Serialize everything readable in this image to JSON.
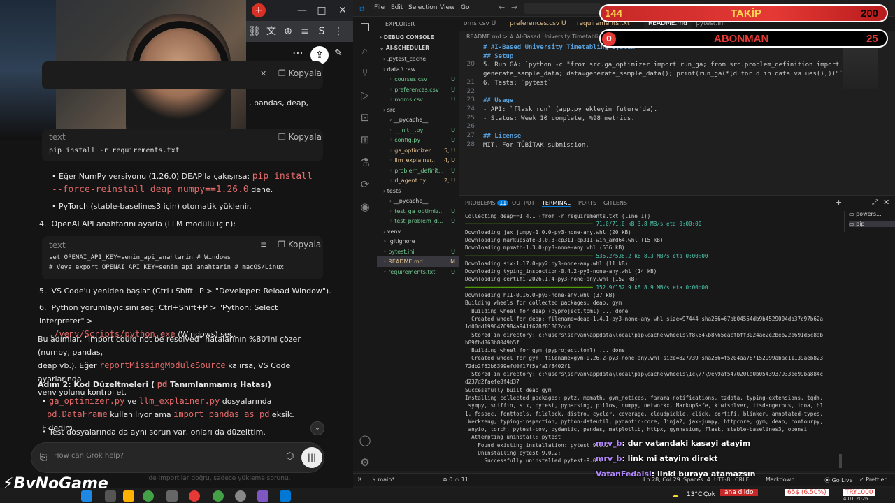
{
  "browser": {
    "kopyala": "Kopyala"
  },
  "chat": {
    "partial_top": ", pandas, deap,",
    "code1": {
      "lang": "text",
      "copy": "Kopyala",
      "line": "pip install -r requirements.txt"
    },
    "bullet1_pre": "Eğer NumPy versiyonu (1.26.0) DEAP'la çakışırsa: ",
    "bullet1_code": "pip install --force-reinstall deap numpy==1.26.0",
    "bullet1_post": " dene.",
    "bullet2": "PyTorch (stable-baselines3 için) otomatik yüklenir.",
    "step4": "OpenAI API anahtarını ayarla (LLM modülü için):",
    "code2": {
      "lang": "text",
      "copy": "Kopyala",
      "line1": "set OPENAI_API_KEY=senin_api_anahtarin  # Windows",
      "line2": "# Veya export OPENAI_API_KEY=senin_api_anahtarin  # macOS/Linux"
    },
    "step5": "VS Code'u yeniden başlat (Ctrl+Shift+P > \"Developer: Reload Window\").",
    "step6_pre": "Python yorumlayıcısını seç: Ctrl+Shift+P > \"Python: Select Interpreter\" >",
    "step6_code": "./venv/Scripts/python.exe",
    "step6_post": " (Windows) seç.",
    "para1": "Bu adımlar, \"Import could not be resolved\" hatalarının %80'ini çözer (numpy, pandas,",
    "para2_pre": "deap vb.). Eğer ",
    "para2_code": "reportMissingModuleSource",
    "para2_post": " kalırsa, VS Code ayarlarında",
    "para3": "venv yolunu kontrol et.",
    "heading_pre": "Adım 2: Kod Düzeltmeleri ( ",
    "heading_code": "pd",
    "heading_post": " Tanımlanmamış Hatası)",
    "b3_code1": "ga_optimizer.py",
    "b3_mid": " ve ",
    "b3_code2": "llm_explainer.py",
    "b3_post": " dosyalarında",
    "b4_code1": "pd.DataFrame",
    "b4_mid": " kullanılıyor ama ",
    "b4_code2": "import pandas as pd",
    "b4_post": " eksik. Ekledim.",
    "b5": "Test dosyalarında da aynı sorun var, onları da düzelttim.",
    "input_placeholder": "How can Grok help?",
    "behind_text": "'de import'lar doğru, sadece yükleme sorunu."
  },
  "brand": "ByNoGame",
  "vscode": {
    "menu": [
      "File",
      "Edit",
      "Selection",
      "View",
      "Go"
    ],
    "explorer_title": "EXPLORER",
    "debug_console": "DEBUG CONSOLE",
    "project": "AI-SCHEDULER",
    "files": [
      {
        "name": ".pytest_cache",
        "badge": "",
        "indent": 1,
        "folder": true
      },
      {
        "name": "data \\ raw",
        "badge": "",
        "indent": 1,
        "folder": true
      },
      {
        "name": "courses.csv",
        "badge": "U",
        "indent": 2,
        "folder": false
      },
      {
        "name": "preferences.csv",
        "badge": "U",
        "indent": 2,
        "folder": false
      },
      {
        "name": "rooms.csv",
        "badge": "U",
        "indent": 2,
        "folder": false
      },
      {
        "name": "src",
        "badge": "",
        "indent": 1,
        "folder": true
      },
      {
        "name": "__pycache__",
        "badge": "",
        "indent": 2,
        "folder": true
      },
      {
        "name": "__init__.py",
        "badge": "U",
        "indent": 2,
        "folder": false
      },
      {
        "name": "config.py",
        "badge": "U",
        "indent": 2,
        "folder": false
      },
      {
        "name": "ga_optimizer...",
        "badge": "5, U",
        "indent": 2,
        "folder": false
      },
      {
        "name": "llm_explainer...",
        "badge": "4, U",
        "indent": 2,
        "folder": false
      },
      {
        "name": "problem_definit...",
        "badge": "U",
        "indent": 2,
        "folder": false
      },
      {
        "name": "rl_agent.py",
        "badge": "2, U",
        "indent": 2,
        "folder": false
      },
      {
        "name": "tests",
        "badge": "",
        "indent": 1,
        "folder": true
      },
      {
        "name": "__pycache__",
        "badge": "",
        "indent": 2,
        "folder": true
      },
      {
        "name": "test_ga_optimiz...",
        "badge": "U",
        "indent": 2,
        "folder": false
      },
      {
        "name": "test_problem_d...",
        "badge": "U",
        "indent": 2,
        "folder": false
      },
      {
        "name": "venv",
        "badge": "",
        "indent": 1,
        "folder": true
      },
      {
        "name": ".gitignore",
        "badge": "",
        "indent": 1,
        "folder": false
      },
      {
        "name": "pytest.ini",
        "badge": "U",
        "indent": 1,
        "folder": false
      },
      {
        "name": "README.md",
        "badge": "M",
        "indent": 1,
        "folder": false
      },
      {
        "name": "requirements.txt",
        "badge": "U",
        "indent": 1,
        "folder": false
      }
    ],
    "tabs": [
      "oms.csv U",
      "preferences.csv U",
      "requirements.txt",
      "README.md",
      "pytest.ini"
    ],
    "breadcrumb": "README.md > # AI-Based University Timetabling System > ## License",
    "code": [
      {
        "n": "",
        "t": "# AI-Based University Timetabling System"
      },
      {
        "n": "",
        "t": "## Setup"
      },
      {
        "n": "20",
        "t": "5. Run GA: `python -c \"from src.ga_optimizer import run_ga; from src.problem_definition import"
      },
      {
        "n": "",
        "t": "generate_sample_data; data=generate_sample_data(); print(run_ga(*[d for d in data.values()]))\"`"
      },
      {
        "n": "21",
        "t": "6. Tests: `pytest`"
      },
      {
        "n": "22",
        "t": ""
      },
      {
        "n": "23",
        "t": "## Usage"
      },
      {
        "n": "24",
        "t": "- API: `flask run` (app.py ekleyin future'da)."
      },
      {
        "n": "25",
        "t": "- Status: Week 10 complete, %98 metrics."
      },
      {
        "n": "26",
        "t": ""
      },
      {
        "n": "27",
        "t": "## License"
      },
      {
        "n": "28",
        "t": "MIT. For TÜBİTAK submission."
      }
    ],
    "panel_tabs": [
      "PROBLEMS",
      "OUTPUT",
      "TERMINAL",
      "PORTS",
      "GITLENS"
    ],
    "problems_count": "11",
    "terminal_list": [
      "powers...",
      "pip"
    ],
    "terminal": [
      "Collecting deap==1.4.1 (from -r requirements.txt (line 1))",
      "BAR|71.0/71.0 kB 3.8 MB/s eta 0:00:00",
      "Downloading jax_jumpy-1.0.0-py3-none-any.whl (20 kB)",
      "Downloading markupsafe-3.0.3-cp311-cp311-win_amd64.whl (15 kB)",
      "Downloading mpmath-1.3.0-py3-none-any.whl (536 kB)",
      "BAR|536.2/536.2 kB 8.3 MB/s eta 0:00:00",
      "Downloading six-1.17.0-py2.py3-none-any.whl (11 kB)",
      "Downloading typing_inspection-0.4.2-py3-none-any.whl (14 kB)",
      "Downloading certifi-2026.1.4-py3-none-any.whl (152 kB)",
      "BAR|152.9/152.9 kB 8.9 MB/s eta 0:00:00",
      "Downloading h11-0.16.0-py3-none-any.whl (37 kB)",
      "Building wheels for collected packages: deap, gym",
      "  Building wheel for deap (pyproject.toml) ... done",
      "  Created wheel for deap: filename=deap-1.4.1-py3-none-any.whl size=97444 sha256=67ab04554db9b4529004db37c97b62a",
      "1d00dd1996476984a941f678f81862ccd",
      "  Stored in directory: c:\\users\\servan\\appdata\\local\\pip\\cache\\wheels\\f8\\64\\b8\\65eacfbff3024ae2e2beb22e691d5c8ab",
      "b89fbd863b8049b5f",
      "  Building wheel for gym (pyproject.toml) ... done",
      "  Created wheel for gym: filename=gym-0.26.2-py3-none-any.whl size=827739 sha256=f5204aa787152999abac11139aeb823",
      "72db2f62b6399efd0f17f5afa1f8402f1",
      "  Stored in directory: c:\\users\\servan\\appdata\\local\\pip\\cache\\wheels\\1c\\77\\9e\\9af547020la0b0543937933ee99ba884c",
      "d237d2faefe8f4d37",
      "Successfully built deap gym",
      "Installing collected packages: pytz, mpmath, gym_notices, farama-notifications, tzdata, typing-extensions, tqdm,",
      " sympy, sniffio, six, pytest, pyparsing, pillow, numpy, networkx, MarkupSafe, kiwisolver, itsdangerous, idna, h1",
      "1, fsspec, fonttools, filelock, distro, cycler, coverage, cloudpickle, click, certifi, blinker, annotated-types,",
      " Werkzeug, typing-inspection, python-dateutil, pydantic-core, Jinja2, jax-jumpy, httpcore, gym, deap, contourpy,",
      " anyio, torch, pytest-cov, pydantic, pandas, matplotlib, httpx, gymnasium, flask, stable-baselines3, openai",
      "  Attempting uninstall: pytest",
      "    Found existing installation: pytest 9.0.2",
      "    Uninstalling pytest-9.0.2:",
      "      Successfully uninstalled pytest-9.0.2"
    ],
    "status": {
      "branch": "main*",
      "errors": "0",
      "warnings": "11",
      "pos": "Ln 28, Col 29",
      "spaces": "Spaces: 4",
      "enc": "UTF-8",
      "eol": "CRLF",
      "lang": "Markdown",
      "live": "Go Live",
      "prettier": "Prettier"
    }
  },
  "overlay": {
    "takip_left": "144",
    "takip_label": "TAKİP",
    "takip_right": "200",
    "abone_left": "0",
    "abone_label": "ABONMAN",
    "abone_right": "25",
    "chat": [
      {
        "user": "mrv_b",
        "msg": ": dur vatandaki kasayi atayim"
      },
      {
        "user": "mrv_b",
        "msg": ": link mi atayim direkt"
      },
      {
        "user": "VatanFedaisi",
        "msg": ": linki buraya atamazsın"
      }
    ]
  },
  "taskbar": {
    "weather": "13°C",
    "weather_text": "Çok",
    "ticker": "ana dildo",
    "stock": "65$ (6.50%)",
    "currency": "TRY1000",
    "date": "4.01.2026"
  },
  "colors": {
    "accent_red": "#e53935",
    "vscode_blue": "#0078d4",
    "git_green": "#73c991",
    "modified": "#e2c08d",
    "string_red": "#e36a6a"
  }
}
